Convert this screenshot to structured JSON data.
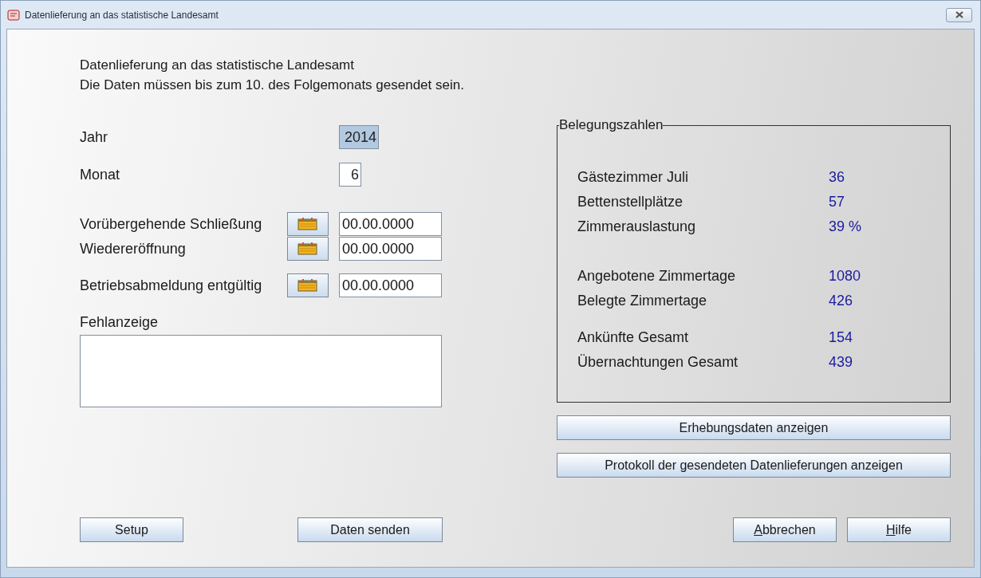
{
  "window": {
    "title": "Datenlieferung an das statistische Landesamt"
  },
  "intro": [
    "Datenlieferung an das statistische Landesamt",
    "Die Daten müssen bis zum 10. des Folgemonats gesendet sein."
  ],
  "year": {
    "label": "Jahr",
    "value": "2014",
    "selected": true
  },
  "month": {
    "label": "Monat",
    "value": "6",
    "selected": false
  },
  "date_rows": [
    {
      "label": "Vorübergehende Schließung",
      "value": "00.00.0000"
    },
    {
      "label": "Wiedereröffnung",
      "value": "00.00.0000"
    },
    {
      "label": "Betriebsabmeldung entgültig",
      "value": "00.00.0000"
    }
  ],
  "fehlanzeige": {
    "label": "Fehlanzeige"
  },
  "stats": {
    "title": "Belegungszahlen",
    "groups": [
      [
        {
          "label": "Gästezimmer Juli",
          "value": "36"
        },
        {
          "label": "Bettenstellplätze",
          "value": "57"
        },
        {
          "label": "Zimmerauslastung",
          "value": "39 %"
        }
      ],
      [
        {
          "label": "Angebotene Zimmertage",
          "value": "1080"
        },
        {
          "label": "Belegte Zimmertage",
          "value": "426"
        }
      ],
      [
        {
          "label": "Ankünfte Gesamt",
          "value": "154"
        },
        {
          "label": "Übernachtungen Gesamt",
          "value": "439"
        }
      ]
    ]
  },
  "side_buttons": [
    "Erhebungsdaten anzeigen",
    "Protokoll der gesendeten Datenlieferungen anzeigen"
  ],
  "bottom_left_buttons": [
    {
      "label": "Setup",
      "mnemonic": false
    },
    {
      "label": "Daten senden",
      "mnemonic": false
    }
  ],
  "bottom_right_buttons": [
    {
      "label": "Abbrechen",
      "mnemonic": true
    },
    {
      "label": "Hilfe",
      "mnemonic": true
    }
  ]
}
